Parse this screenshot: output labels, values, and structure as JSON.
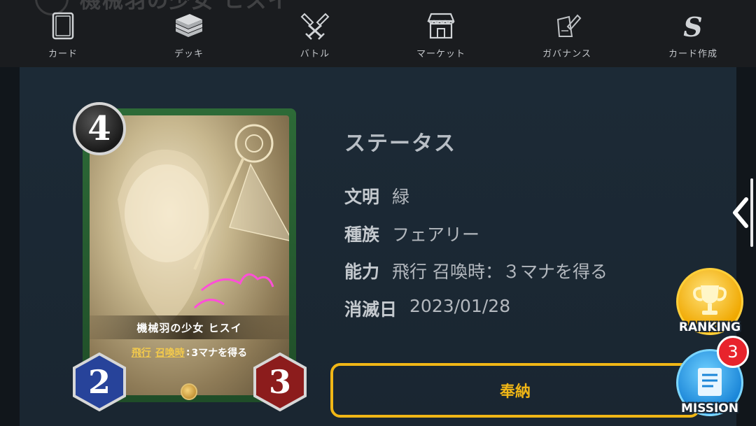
{
  "header": {
    "title": "機械羽の少女 ヒスイ"
  },
  "nav": {
    "items": [
      {
        "label": "カード",
        "icon": "card-icon"
      },
      {
        "label": "デッキ",
        "icon": "deck-icon"
      },
      {
        "label": "バトル",
        "icon": "battle-icon"
      },
      {
        "label": "マーケット",
        "icon": "market-icon"
      },
      {
        "label": "ガバナンス",
        "icon": "governance-icon"
      },
      {
        "label": "カード作成",
        "icon": "card-create-icon"
      }
    ]
  },
  "card": {
    "name": "機械羽の少女 ヒスイ",
    "cost": "4",
    "attack": "2",
    "defense": "3",
    "ability_keyword1": "飛行",
    "ability_keyword2": "召喚時",
    "ability_sep": ":",
    "ability_text": "3マナを得る",
    "frame_color": "#2d6a37"
  },
  "status": {
    "title": "ステータス",
    "rows": [
      {
        "key": "文明",
        "value": "緑"
      },
      {
        "key": "種族",
        "value": "フェアリー"
      },
      {
        "key": "能力",
        "value": "飛行 召喚時：３マナを得る"
      },
      {
        "key": "消滅日",
        "value": "2023/01/28"
      }
    ]
  },
  "actions": {
    "dedicate_label": "奉納"
  },
  "floating": {
    "ranking_label": "RANKING",
    "mission_label": "MISSION",
    "mission_badge": "3"
  },
  "colors": {
    "accent": "#f0b616",
    "panel": "#1c2a36"
  }
}
